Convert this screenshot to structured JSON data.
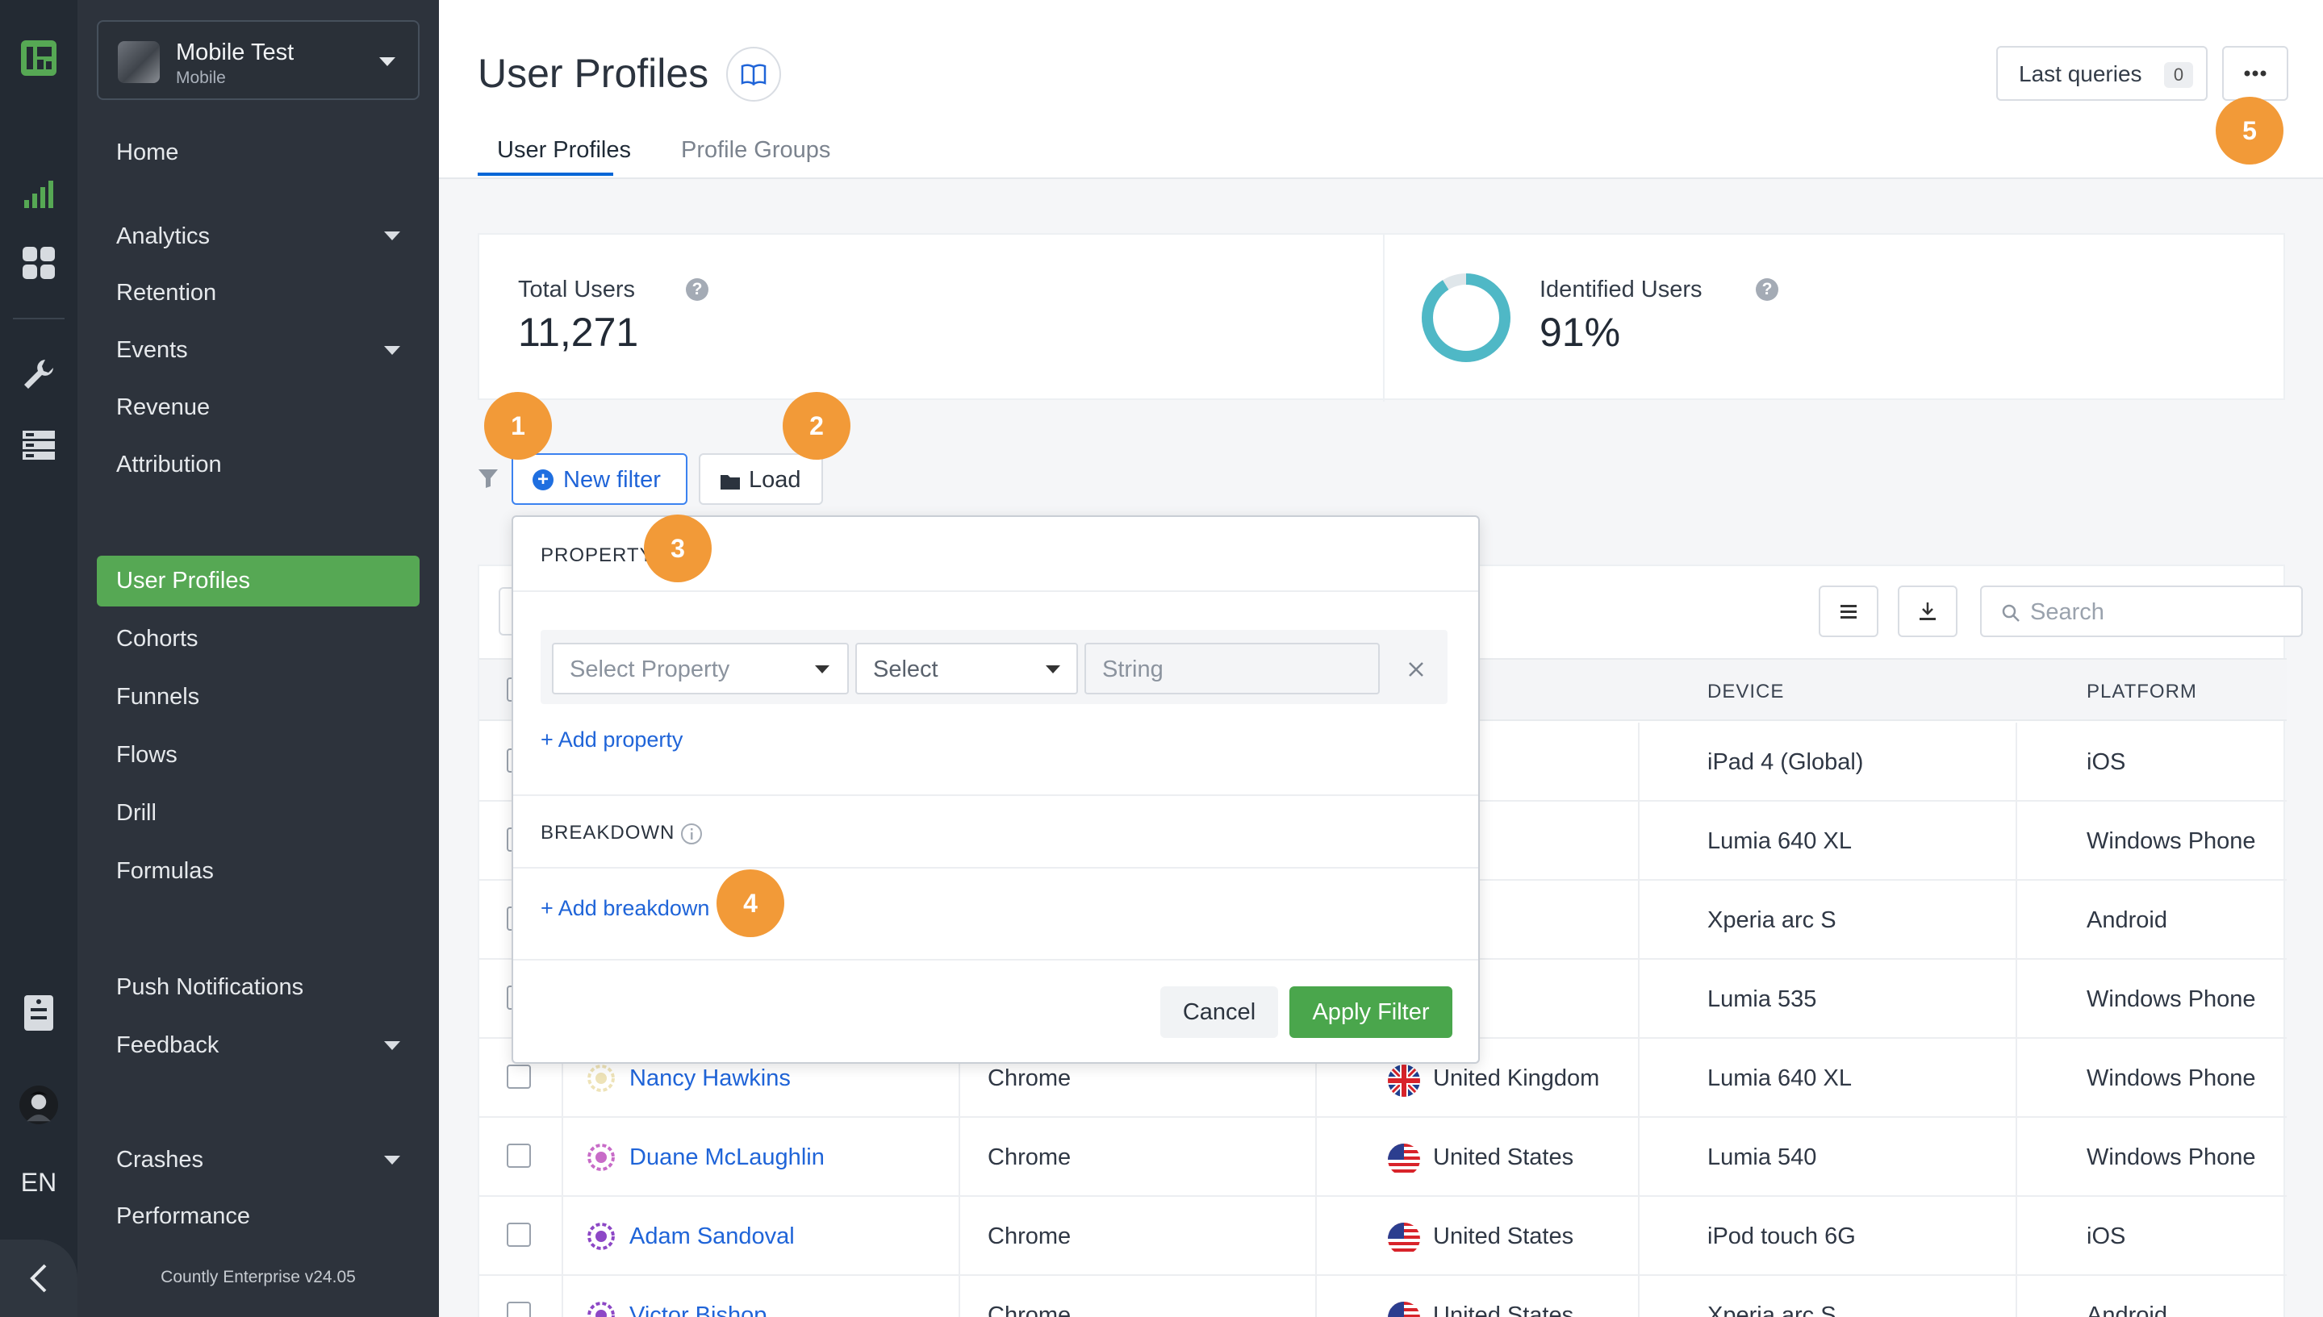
{
  "app": {
    "name": "Mobile Test",
    "type": "Mobile"
  },
  "sidebar": {
    "items": [
      {
        "label": "Home"
      },
      {
        "label": "Analytics"
      },
      {
        "label": "Retention"
      },
      {
        "label": "Events"
      },
      {
        "label": "Revenue"
      },
      {
        "label": "Attribution"
      },
      {
        "label": "User Profiles"
      },
      {
        "label": "Cohorts"
      },
      {
        "label": "Funnels"
      },
      {
        "label": "Flows"
      },
      {
        "label": "Drill"
      },
      {
        "label": "Formulas"
      },
      {
        "label": "Push Notifications"
      },
      {
        "label": "Feedback"
      },
      {
        "label": "Crashes"
      },
      {
        "label": "Performance"
      }
    ],
    "version": "Countly Enterprise v24.05",
    "language": "EN"
  },
  "header": {
    "title": "User Profiles",
    "tabs": [
      {
        "label": "User Profiles"
      },
      {
        "label": "Profile Groups"
      }
    ],
    "last_queries_label": "Last queries",
    "last_queries_count": "0"
  },
  "stats": {
    "total_users_label": "Total Users",
    "total_users_value": "11,271",
    "identified_users_label": "Identified Users",
    "identified_users_value": "91%",
    "identified_fraction": 0.91
  },
  "filter": {
    "new_filter_label": "New filter",
    "load_label": "Load",
    "property_title": "PROPERTY",
    "select_property_placeholder": "Select Property",
    "operator_placeholder": "Select",
    "value_type": "String",
    "add_property_label": "+ Add property",
    "breakdown_title": "BREAKDOWN",
    "add_breakdown_label": "+ Add breakdown",
    "cancel_label": "Cancel",
    "apply_label": "Apply Filter"
  },
  "markers": [
    "1",
    "2",
    "3",
    "4",
    "5"
  ],
  "table": {
    "search_placeholder": "Search",
    "columns": [
      "DEVICE",
      "PLATFORM"
    ],
    "rows": [
      {
        "name": "",
        "browser": "",
        "country": "",
        "device": "iPad 4 (Global)",
        "platform": "iOS"
      },
      {
        "name": "",
        "browser": "",
        "country": "",
        "device": "Lumia 640 XL",
        "platform": "Windows Phone"
      },
      {
        "name": "",
        "browser": "",
        "country": "",
        "device": "Xperia arc S",
        "platform": "Android"
      },
      {
        "name": "",
        "browser": "",
        "country": "",
        "device": "Lumia 535",
        "platform": "Windows Phone"
      },
      {
        "name": "Nancy Hawkins",
        "browser": "Chrome",
        "country": "United Kingdom",
        "device": "Lumia 640 XL",
        "platform": "Windows Phone"
      },
      {
        "name": "Duane McLaughlin",
        "browser": "Chrome",
        "country": "United States",
        "device": "Lumia 540",
        "platform": "Windows Phone"
      },
      {
        "name": "Adam Sandoval",
        "browser": "Chrome",
        "country": "United States",
        "device": "iPod touch 6G",
        "platform": "iOS"
      },
      {
        "name": "Victor Bishop",
        "browser": "Chrome",
        "country": "United States",
        "device": "Xperia arc S",
        "platform": "Android"
      }
    ]
  },
  "colors": {
    "accent_green": "#56a854",
    "link_blue": "#1f64d8",
    "marker_orange": "#f29a38",
    "donut_teal": "#4fb8c6"
  }
}
